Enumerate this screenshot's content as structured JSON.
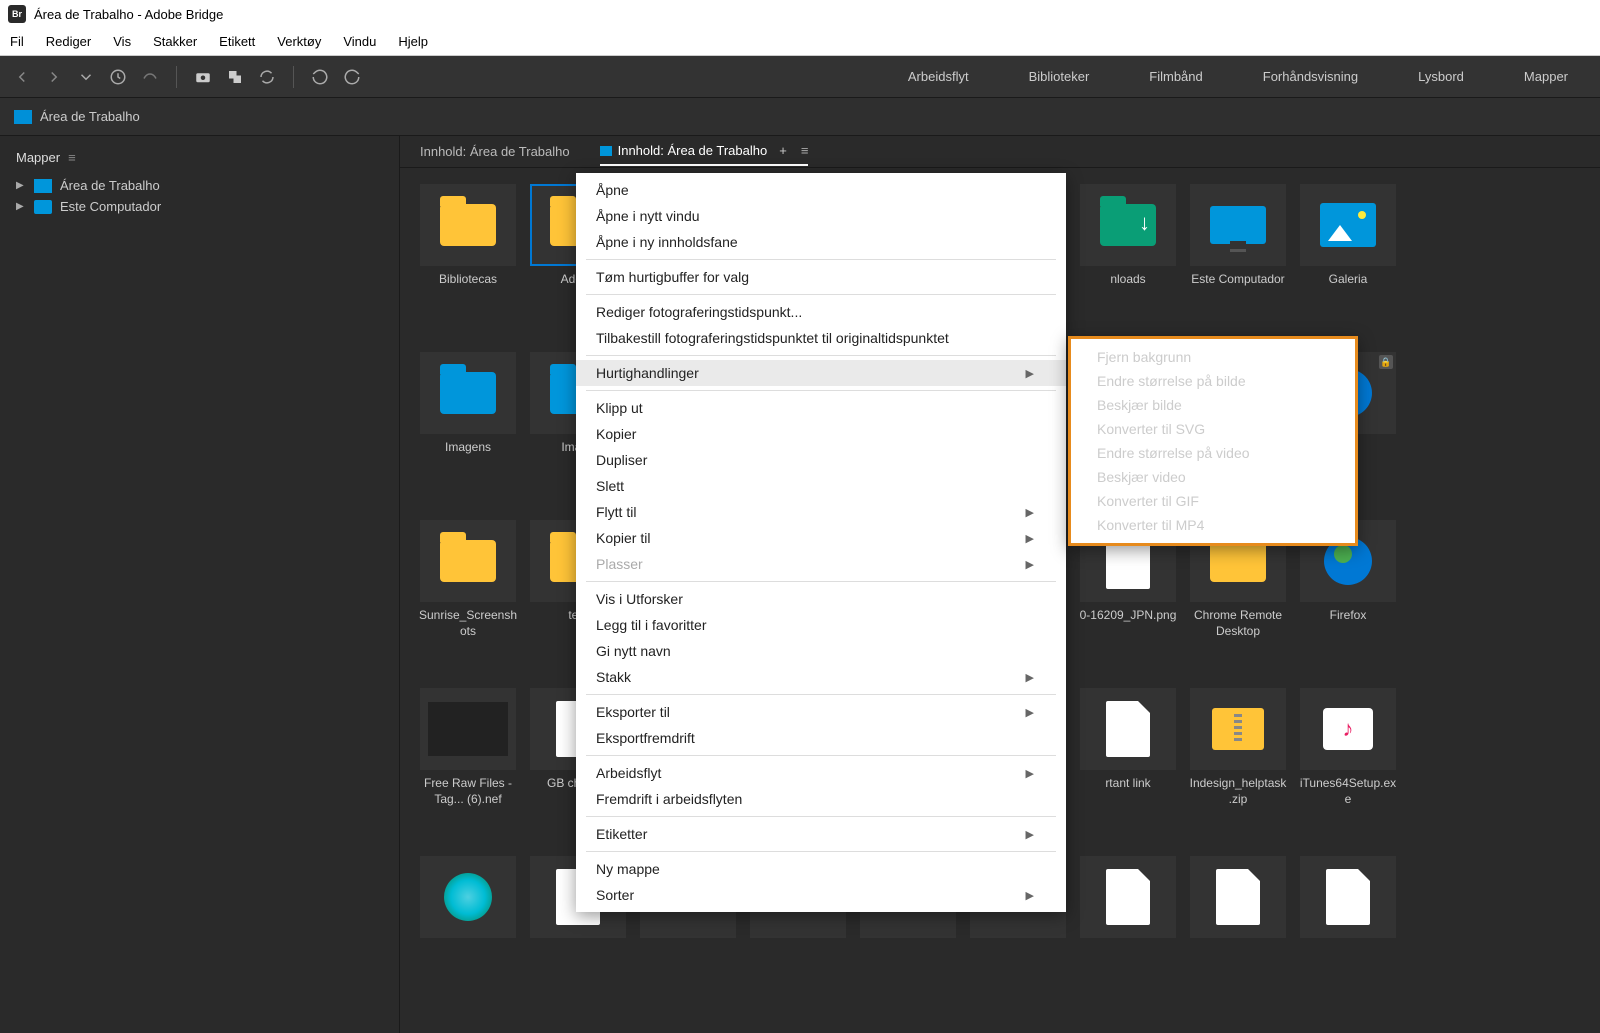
{
  "title": "Área de Trabalho - Adobe Bridge",
  "app_abbr": "Br",
  "menus": [
    "Fil",
    "Rediger",
    "Vis",
    "Stakker",
    "Etikett",
    "Verktøy",
    "Vindu",
    "Hjelp"
  ],
  "workspaces": [
    "Arbeidsflyt",
    "Biblioteker",
    "Filmbånd",
    "Forhåndsvisning",
    "Lysbord",
    "Mapper"
  ],
  "path": "Área de Trabalho",
  "sidebar": {
    "panel": "Mapper",
    "items": [
      {
        "label": "Área de Trabalho",
        "icon": "folder"
      },
      {
        "label": "Este Computador",
        "icon": "monitor"
      }
    ]
  },
  "tabs": {
    "left": "Innhold: Área de Trabalho",
    "right": "Innhold: Área de Trabalho"
  },
  "grid_items": [
    {
      "label": "Bibliotecas",
      "icon": "folder-y"
    },
    {
      "label": "Adobe",
      "icon": "folder-y",
      "selected": true
    },
    {
      "label": "",
      "icon": "folder-b"
    },
    {
      "label": "",
      "icon": "folder-y"
    },
    {
      "label": "",
      "icon": "folder-y"
    },
    {
      "label": "",
      "icon": "sw"
    },
    {
      "label": "nloads",
      "icon": "folder-dl"
    },
    {
      "label": "Este Computador",
      "icon": "monitor"
    },
    {
      "label": "Galeria",
      "icon": "picture"
    },
    {
      "label": "Imagens",
      "icon": "folder-b"
    },
    {
      "label": "Image",
      "icon": "folder-b"
    },
    {
      "label": "",
      "icon": "none"
    },
    {
      "label": "",
      "icon": "none"
    },
    {
      "label": "",
      "icon": "none"
    },
    {
      "label": "",
      "icon": "none"
    },
    {
      "label": "",
      "icon": "cloud"
    },
    {
      "label": "",
      "icon": "folder-y"
    },
    {
      "label": "",
      "icon": "globe",
      "locked": true
    },
    {
      "label": "Sunrise_Screenshots",
      "icon": "folder-y"
    },
    {
      "label": "test",
      "icon": "folder-y"
    },
    {
      "label": "",
      "icon": "none"
    },
    {
      "label": "",
      "icon": "none"
    },
    {
      "label": "",
      "icon": "none"
    },
    {
      "label": "",
      "icon": "none"
    },
    {
      "label": "0-16209_JPN.png",
      "icon": "file"
    },
    {
      "label": "Chrome Remote Desktop",
      "icon": "folder-y"
    },
    {
      "label": "Firefox",
      "icon": "globe"
    },
    {
      "label": "Free Raw Files - Tag... (6).nef",
      "icon": "photo"
    },
    {
      "label": "GB chet file",
      "icon": "file"
    },
    {
      "label": "",
      "icon": "none"
    },
    {
      "label": "",
      "icon": "none"
    },
    {
      "label": "",
      "icon": "none"
    },
    {
      "label": "",
      "icon": "none"
    },
    {
      "label": "rtant link",
      "icon": "file"
    },
    {
      "label": "Indesign_helptask.zip",
      "icon": "zip"
    },
    {
      "label": "iTunes64Setup.exe",
      "icon": "box"
    },
    {
      "label": "",
      "icon": "edge"
    },
    {
      "label": "",
      "icon": "file"
    },
    {
      "label": "",
      "icon": "none"
    },
    {
      "label": "",
      "icon": "none"
    },
    {
      "label": "",
      "icon": "none"
    },
    {
      "label": "",
      "icon": "none"
    },
    {
      "label": "",
      "icon": "file"
    },
    {
      "label": "",
      "icon": "file"
    },
    {
      "label": "",
      "icon": "file"
    }
  ],
  "context_menu": {
    "groups": [
      [
        "Åpne",
        "Åpne i nytt vindu",
        "Åpne i ny innholdsfane"
      ],
      [
        "Tøm hurtigbuffer for valg"
      ],
      [
        "Rediger fotograferingstidspunkt...",
        "Tilbakestill fotograferingstidspunktet til originaltidspunktet"
      ],
      [
        {
          "label": "Hurtighandlinger",
          "arrow": true,
          "highlight": true
        }
      ],
      [
        "Klipp ut",
        "Kopier",
        "Dupliser",
        "Slett",
        {
          "label": "Flytt til",
          "arrow": true
        },
        {
          "label": "Kopier til",
          "arrow": true
        },
        {
          "label": "Plasser",
          "arrow": true,
          "disabled": true
        }
      ],
      [
        "Vis i Utforsker",
        "Legg til i favoritter",
        "Gi nytt navn",
        {
          "label": "Stakk",
          "arrow": true
        }
      ],
      [
        {
          "label": "Eksporter til",
          "arrow": true
        },
        "Eksportfremdrift"
      ],
      [
        {
          "label": "Arbeidsflyt",
          "arrow": true
        },
        "Fremdrift i arbeidsflyten"
      ],
      [
        {
          "label": "Etiketter",
          "arrow": true
        }
      ],
      [
        "Ny mappe",
        {
          "label": "Sorter",
          "arrow": true
        }
      ]
    ]
  },
  "submenu_items": [
    "Fjern bakgrunn",
    "Endre størrelse på bilde",
    "Beskjær bilde",
    "Konverter til SVG",
    "Endre størrelse på video",
    "Beskjær video",
    "Konverter til GIF",
    "Konverter til MP4"
  ]
}
